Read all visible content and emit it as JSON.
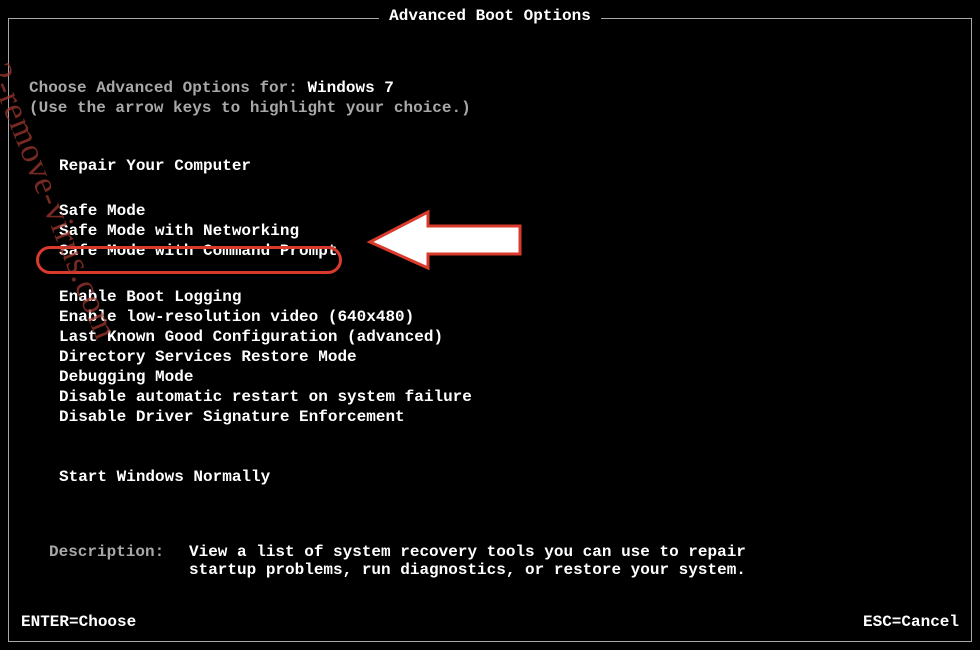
{
  "title": "Advanced Boot Options",
  "choose_prefix": "Choose Advanced Options for: ",
  "os_name": "Windows 7",
  "hint": "(Use the arrow keys to highlight your choice.)",
  "repair_item": "Repair Your Computer",
  "safe_modes": [
    "Safe Mode",
    "Safe Mode with Networking",
    "Safe Mode with Command Prompt"
  ],
  "options": [
    "Enable Boot Logging",
    "Enable low-resolution video (640x480)",
    "Last Known Good Configuration (advanced)",
    "Directory Services Restore Mode",
    "Debugging Mode",
    "Disable automatic restart on system failure",
    "Disable Driver Signature Enforcement"
  ],
  "start_normal": "Start Windows Normally",
  "description_label": "Description:",
  "description_text": "View a list of system recovery tools you can use to repair startup problems, run diagnostics, or restore your system.",
  "footer_left": "ENTER=Choose",
  "footer_right": "ESC=Cancel",
  "watermark": "2-remove-virus.com",
  "highlight_color": "#d93a2b"
}
